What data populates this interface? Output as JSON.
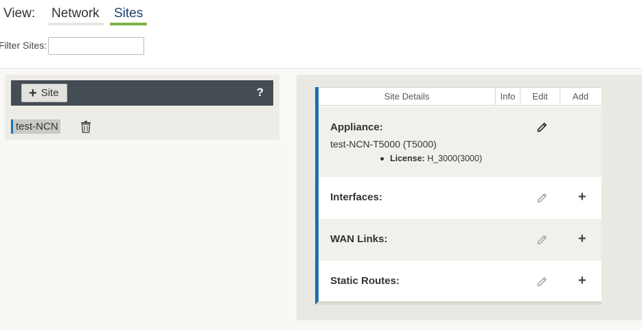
{
  "view": {
    "label": "View:",
    "tabs": [
      {
        "label": "Network",
        "active": false
      },
      {
        "label": "Sites",
        "active": true
      }
    ]
  },
  "filter": {
    "label": "Filter Sites:",
    "value": ""
  },
  "site_panel": {
    "add_button_label": "Site",
    "help_label": "?",
    "sites": [
      "test-NCN"
    ]
  },
  "site_details": {
    "headers": {
      "details": "Site Details",
      "info": "Info",
      "edit": "Edit",
      "add": "Add"
    },
    "appliance": {
      "title": "Appliance:",
      "name": "test-NCN-T5000 (T5000)",
      "license_label": "License:",
      "license_value": "H_3000(3000)"
    },
    "sections": [
      {
        "title": "Interfaces:"
      },
      {
        "title": "WAN Links:"
      },
      {
        "title": "Static Routes:"
      }
    ]
  },
  "colors": {
    "accent_blue": "#1a6fb0",
    "active_tab_underline": "#7ab648",
    "toolbar_dark": "#444c54"
  }
}
